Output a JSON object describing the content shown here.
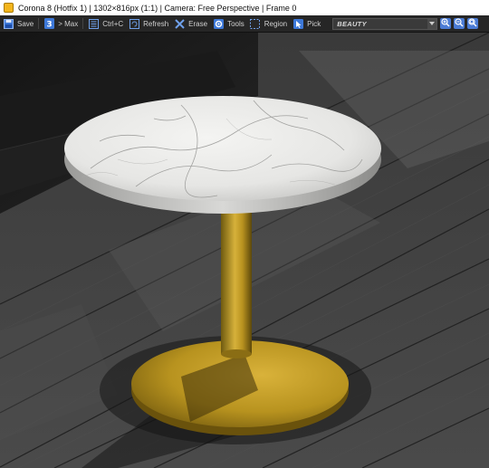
{
  "window": {
    "title": "Corona 8 (Hotfix 1) | 1302×816px (1:1) | Camera: Free Perspective | Frame 0"
  },
  "toolbar": {
    "save_label": "Save",
    "max_label": "> Max",
    "copy_label": "Ctrl+C",
    "refresh_label": "Refresh",
    "erase_label": "Erase",
    "tools_label": "Tools",
    "region_label": "Region",
    "pick_label": "Pick",
    "render_pass": "BEAUTY"
  },
  "icons": {
    "save": "save-icon",
    "max": "max-icon",
    "copy": "copy-icon",
    "refresh": "refresh-icon",
    "erase": "erase-icon",
    "tools": "gear-icon",
    "region": "region-icon",
    "pick": "pick-icon",
    "zoom_in": "zoom-in-icon",
    "zoom_out": "zoom-out-icon",
    "zoom_fit": "zoom-fit-icon"
  },
  "colors": {
    "toolbar_bg": "#262626",
    "accent_blue": "#4a7bd4",
    "app_icon": "#f3b51b"
  }
}
